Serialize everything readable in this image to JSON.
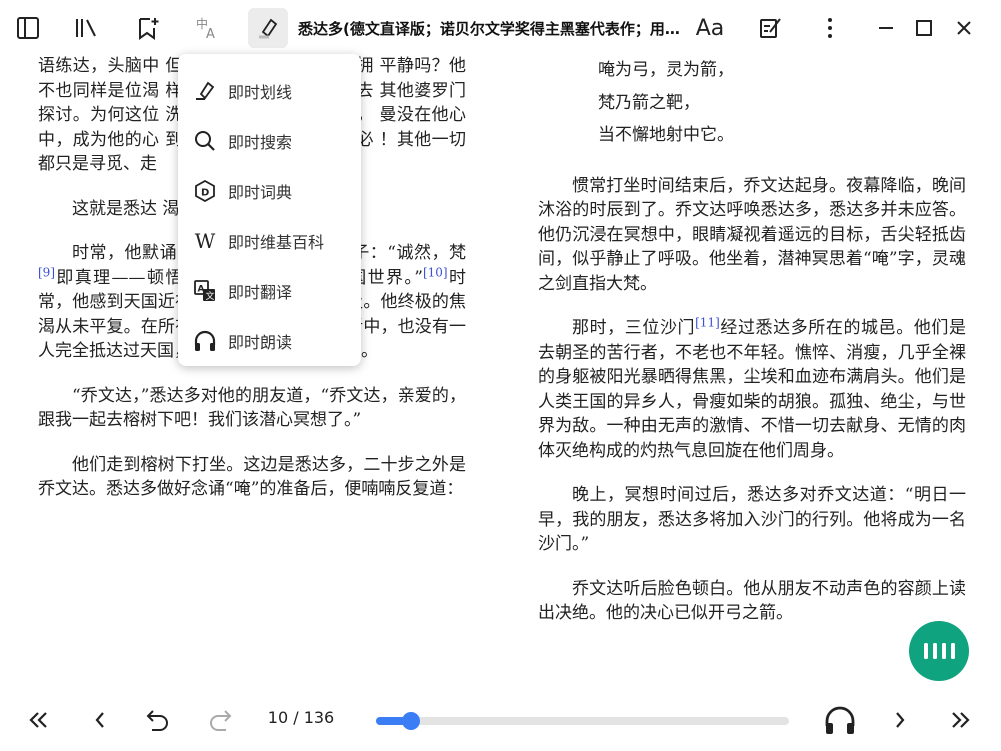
{
  "window": {
    "title": "悉达多(德文直译版；诺贝尔文学奖得主黑塞代表作；用…"
  },
  "toolbar": {
    "icons": [
      "sidebar-toggle-icon",
      "library-icon",
      "bookmark-add-icon",
      "translate-icon",
      "highlighter-icon",
      "font-settings-icon",
      "edit-note-icon",
      "more-vertical-icon"
    ],
    "font_button": "Aa",
    "window_controls": [
      "minimize-icon",
      "maximize-icon",
      "close-icon"
    ]
  },
  "instant_menu": {
    "items": [
      {
        "label": "即时划线",
        "icon": "highlighter-icon"
      },
      {
        "label": "即时搜索",
        "icon": "search-icon"
      },
      {
        "label": "即时词典",
        "icon": "dictionary-icon"
      },
      {
        "label": "即时维基百科",
        "icon": "wikipedia-icon"
      },
      {
        "label": "即时翻译",
        "icon": "translate-icon"
      },
      {
        "label": "即时朗读",
        "icon": "headphones-icon"
      }
    ]
  },
  "left_page": {
    "p1": "语练达，头脑中                                        但如此渊博的父亲，就能拥                                        平静吗？他不也同样是位渴                                        样要不断去圣泉边痛饮，去                                        其他婆罗门探讨。为何这位                                        洗涤罪孽？每日忙于清洁，                                        曼没在他心中，成为他的心                                        到它。内在“我”之源泉，必                                        ！其他一切都只是寻觅、走",
    "p2": "这就是悉达                                        渴望，他的痛苦。",
    "p3_a": "时常，他默诵《歌者奥义书》",
    "p3_b": "中的句子：“诚然，梵",
    "p3_note1": "[9]",
    "p3_c": "即真理——顿悟真理之人日日前往天国世界。”",
    "p3_note2": "[10]",
    "p3_d": "时常，他感到天国近在咫尺，又无法完全够及。他终极的焦渴从未平复。在所有教诲过他的圣贤和智者中，也没有一人完全抵达过天国，完全消除过永恒的焦渴。",
    "p4": "“乔文达，”悉达多对他的朋友道，“乔文达，亲爱的，跟我一起去榕树下吧！我们该潜心冥想了。”",
    "p5": "他们走到榕树下打坐。这边是悉达多，二十步之外是乔文达。悉达多做好念诵“唵”的准备后，便喃喃反复道："
  },
  "right_page": {
    "verse": [
      "唵为弓，灵为箭，",
      "梵乃箭之靶，",
      "当不懈地射中它。"
    ],
    "p1": "惯常打坐时间结束后，乔文达起身。夜幕降临，晚间沐浴的时辰到了。乔文达呼唤悉达多，悉达多并未应答。他仍沉浸在冥想中，眼睛凝视着遥远的目标，舌尖轻抵齿间，似乎静止了呼吸。他坐着，潜神冥思着“唵”字，灵魂之剑直指大梵。",
    "p2_a": "那时，三位沙门",
    "p2_note": "[11]",
    "p2_b": "经过悉达多所在的城邑。他们是去朝圣的苦行者，不老也不年轻。憔悴、消瘦，几乎全裸的身躯被阳光暴晒得焦黑，尘埃和血迹布满肩头。他们是人类王国的异乡人，骨瘦如柴的胡狼。孤独、绝尘，与世界为敌。一种由无声的激情、不惜一切去献身、无情的肉体灭绝构成的灼热气息回旋在他们周身。",
    "p3": "晚上，冥想时间过后，悉达多对乔文达道：“明日一早，我的朋友，悉达多将加入沙门的行列。他将成为一名沙门。”",
    "p4": "乔文达听后脸色顿白。他从朋友不动声色的容颜上读出决绝。他的决心已似开弓之箭。"
  },
  "bottom_bar": {
    "page_indicator": "10 / 136",
    "progress_fraction": 0.085,
    "icons": [
      "skip-back-icon",
      "prev-page-icon",
      "undo-icon",
      "redo-icon",
      "headphones-icon",
      "next-page-icon",
      "skip-forward-icon"
    ]
  },
  "colors": {
    "accent": "#3a7df5",
    "fab": "#0fa37f",
    "note_link": "#3b4fd6"
  }
}
